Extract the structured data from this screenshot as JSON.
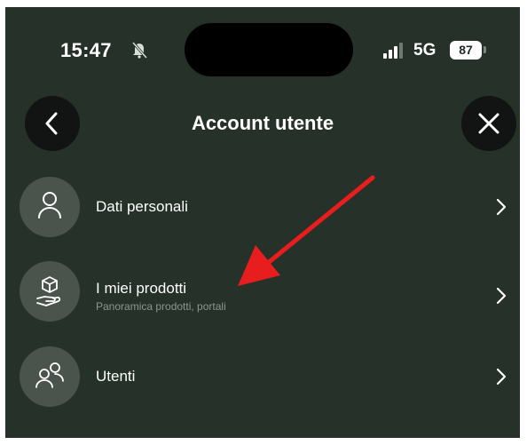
{
  "status_bar": {
    "time": "15:47",
    "network": "5G",
    "battery": "87"
  },
  "header": {
    "title": "Account utente"
  },
  "menu": {
    "items": [
      {
        "label": "Dati personali",
        "icon": "person-icon"
      },
      {
        "label": "I miei prodotti",
        "subtitle": "Panoramica prodotti, portali",
        "icon": "hand-box-icon"
      },
      {
        "label": "Utenti",
        "icon": "users-icon"
      }
    ]
  },
  "colors": {
    "background": "#253129",
    "icon_circle": "#4a544d",
    "annotation": "#e81d1d"
  }
}
